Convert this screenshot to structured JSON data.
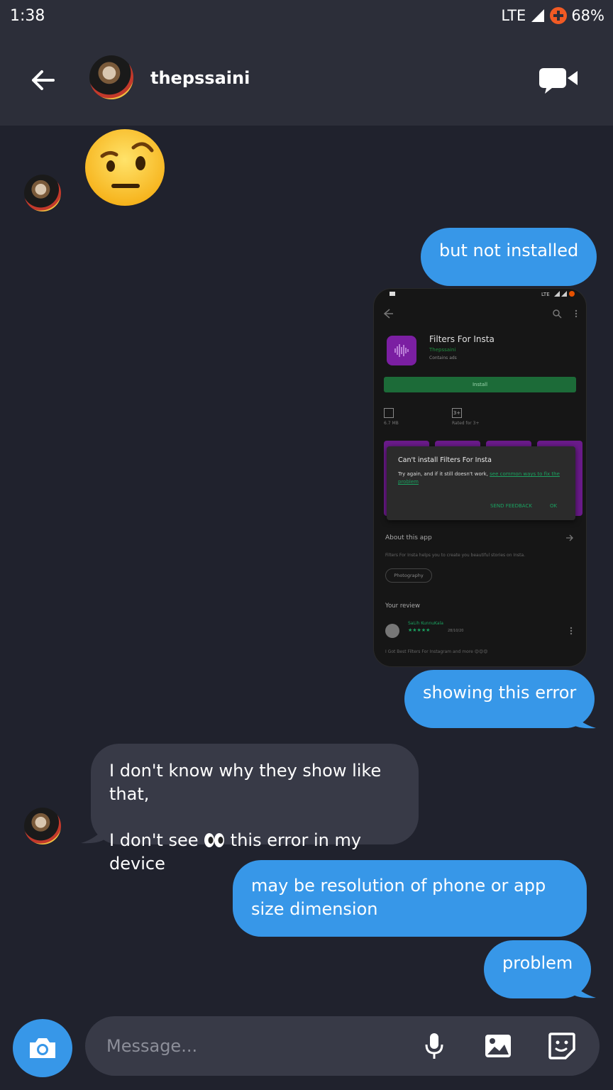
{
  "status_bar": {
    "time": "1:38",
    "network": "LTE",
    "battery": "68%"
  },
  "header": {
    "contact_name": "thepssaini",
    "back_icon": "arrow-back-icon",
    "video_icon": "video-call-icon"
  },
  "messages": {
    "m1_emoji": "face-with-raised-eyebrow",
    "m2": "but not installed",
    "m4": "showing this error",
    "m5_line1": "I don't know why they show like that,",
    "m5_line2a": "I don't see",
    "m5_line2b": "this error in my device",
    "m6": "may be resolution of phone or app size dimension",
    "m7": "problem"
  },
  "screenshot": {
    "app_name": "Filters For Insta",
    "developer": "Thepssaini",
    "ads_note": "Contains ads",
    "install_label": "Install",
    "size": "6.7 MB",
    "rating_label": "Rated for 3+",
    "dialog_title": "Can't install Filters For Insta",
    "dialog_text": "Try again, and if it still doesn't work,",
    "dialog_link": "see common ways to fix the problem",
    "dialog_feedback": "SEND FEEDBACK",
    "dialog_ok": "OK",
    "about_title": "About this app",
    "about_desc": "Filters For Insta helps you to create you beautiful stories on Insta.",
    "category": "Photography",
    "review_title": "Your review",
    "reviewer": "SaLih KunnuKala",
    "stars": "★★★★★",
    "review_date": "28/10/20",
    "review_text": "I Got Best Filters For Instagram and more 😍😍😍"
  },
  "composer": {
    "placeholder": "Message..."
  },
  "colors": {
    "accent": "#3797e8",
    "background": "#20222d",
    "incoming_bubble": "#383a47",
    "header": "#2c2e39"
  }
}
